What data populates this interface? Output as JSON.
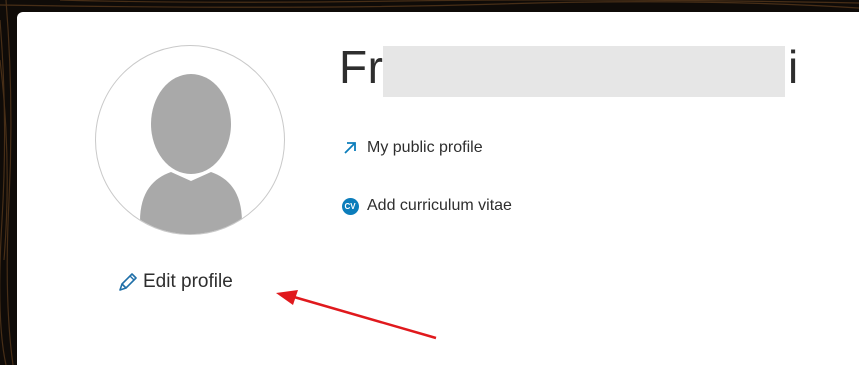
{
  "profile": {
    "name_visible": "Fr",
    "name_last_char": "i",
    "edit_label": "Edit profile",
    "public_profile_label": "My public profile",
    "add_cv_label": "Add curriculum vitae",
    "cv_badge_text": "CV"
  },
  "icons": {
    "edit": "pencil-icon",
    "public_profile": "external-arrow-icon",
    "cv": "cv-badge-icon",
    "avatar": "user-silhouette-icon"
  },
  "colors": {
    "accent_blue": "#0c7dbb",
    "annotation_red": "#e0191d",
    "text": "#2e2e2e",
    "redaction": "#e6e6e6"
  }
}
